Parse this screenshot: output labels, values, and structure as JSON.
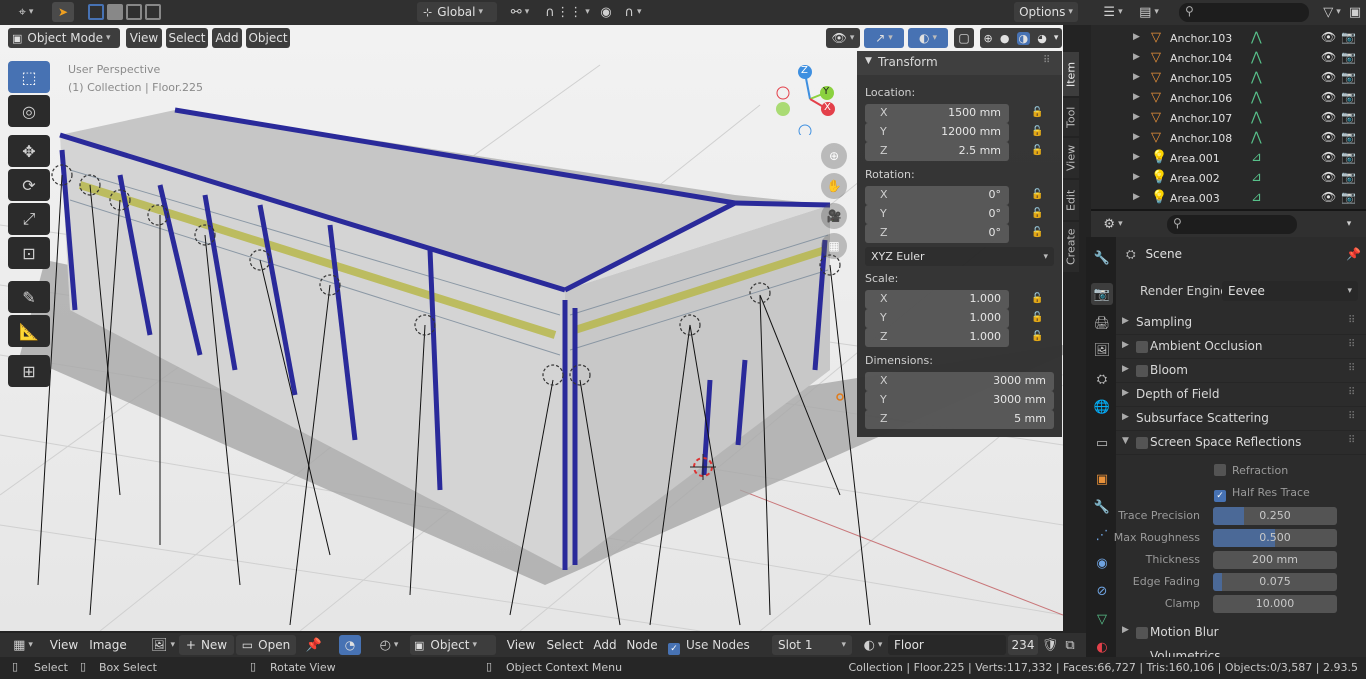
{
  "topbar": {
    "transform_orientation": "Global",
    "options_label": "Options"
  },
  "viewport_header": {
    "mode": "Object Mode",
    "menus": [
      "View",
      "Select",
      "Add",
      "Object"
    ]
  },
  "viewport": {
    "perspective_label": "User Perspective",
    "collection_label": "(1) Collection | Floor.225",
    "gizmo_axes": [
      "Z",
      "Y",
      "X"
    ]
  },
  "npanel": {
    "title": "Transform",
    "location_label": "Location:",
    "location": [
      {
        "axis": "X",
        "value": "1500 mm"
      },
      {
        "axis": "Y",
        "value": "12000 mm"
      },
      {
        "axis": "Z",
        "value": "2.5 mm"
      }
    ],
    "rotation_label": "Rotation:",
    "rotation": [
      {
        "axis": "X",
        "value": "0°"
      },
      {
        "axis": "Y",
        "value": "0°"
      },
      {
        "axis": "Z",
        "value": "0°"
      }
    ],
    "rotation_mode": "XYZ Euler",
    "scale_label": "Scale:",
    "scale": [
      {
        "axis": "X",
        "value": "1.000"
      },
      {
        "axis": "Y",
        "value": "1.000"
      },
      {
        "axis": "Z",
        "value": "1.000"
      }
    ],
    "dimensions_label": "Dimensions:",
    "dimensions": [
      {
        "axis": "X",
        "value": "3000 mm"
      },
      {
        "axis": "Y",
        "value": "3000 mm"
      },
      {
        "axis": "Z",
        "value": "5 mm"
      }
    ],
    "tabs": [
      "Item",
      "Tool",
      "View",
      "Edit",
      "Create"
    ]
  },
  "outliner": {
    "rows": [
      {
        "name": "Anchor.103",
        "kind": "mesh"
      },
      {
        "name": "Anchor.104",
        "kind": "mesh"
      },
      {
        "name": "Anchor.105",
        "kind": "mesh"
      },
      {
        "name": "Anchor.106",
        "kind": "mesh"
      },
      {
        "name": "Anchor.107",
        "kind": "mesh"
      },
      {
        "name": "Anchor.108",
        "kind": "mesh"
      },
      {
        "name": "Area.001",
        "kind": "light"
      },
      {
        "name": "Area.002",
        "kind": "light"
      },
      {
        "name": "Area.003",
        "kind": "light"
      }
    ]
  },
  "properties": {
    "context": "Scene",
    "render_engine_label": "Render Engine",
    "render_engine": "Eevee",
    "panels": [
      {
        "label": "Sampling",
        "checkbox": false,
        "expanded": false
      },
      {
        "label": "Ambient Occlusion",
        "checkbox": true,
        "expanded": false
      },
      {
        "label": "Bloom",
        "checkbox": true,
        "expanded": false
      },
      {
        "label": "Depth of Field",
        "checkbox": false,
        "expanded": false
      },
      {
        "label": "Subsurface Scattering",
        "checkbox": false,
        "expanded": false
      },
      {
        "label": "Screen Space Reflections",
        "checkbox": true,
        "expanded": true
      }
    ],
    "ssr": {
      "refraction_label": "Refraction",
      "refraction_checked": false,
      "half_res_label": "Half Res Trace",
      "half_res_checked": true,
      "sliders": [
        {
          "label": "Trace Precision",
          "value": "0.250",
          "fraction": 0.25
        },
        {
          "label": "Max Roughness",
          "value": "0.500",
          "fraction": 0.5
        },
        {
          "label": "Thickness",
          "value": "200 mm",
          "fraction": 0
        },
        {
          "label": "Edge Fading",
          "value": "0.075",
          "fraction": 0.075
        },
        {
          "label": "Clamp",
          "value": "10.000",
          "fraction": 0
        }
      ]
    },
    "motion_blur_label": "Motion Blur",
    "volumetrics_label": "Volumetrics"
  },
  "editor_footer": {
    "menus_left": [
      "View",
      "Image"
    ],
    "new_label": "New",
    "open_label": "Open",
    "object_label": "Object",
    "menus_right": [
      "View",
      "Select",
      "Add",
      "Node"
    ],
    "use_nodes_label": "Use Nodes",
    "slot_label": "Slot 1",
    "material_name": "Floor",
    "material_users": "234"
  },
  "statusbar": {
    "select_label": "Select",
    "box_select_label": "Box Select",
    "rotate_label": "Rotate View",
    "context_menu_label": "Object Context Menu",
    "stats": "Collection | Floor.225 | Verts:117,332 | Faces:66,727 | Tris:160,106 | Objects:0/3,587 | 2.93.5"
  },
  "colors": {
    "accent": "#4772b3",
    "building_trim": "#2a2a9a",
    "x_axis": "#e3404a",
    "y_axis": "#8bd13f",
    "z_axis": "#3e8fe0"
  }
}
